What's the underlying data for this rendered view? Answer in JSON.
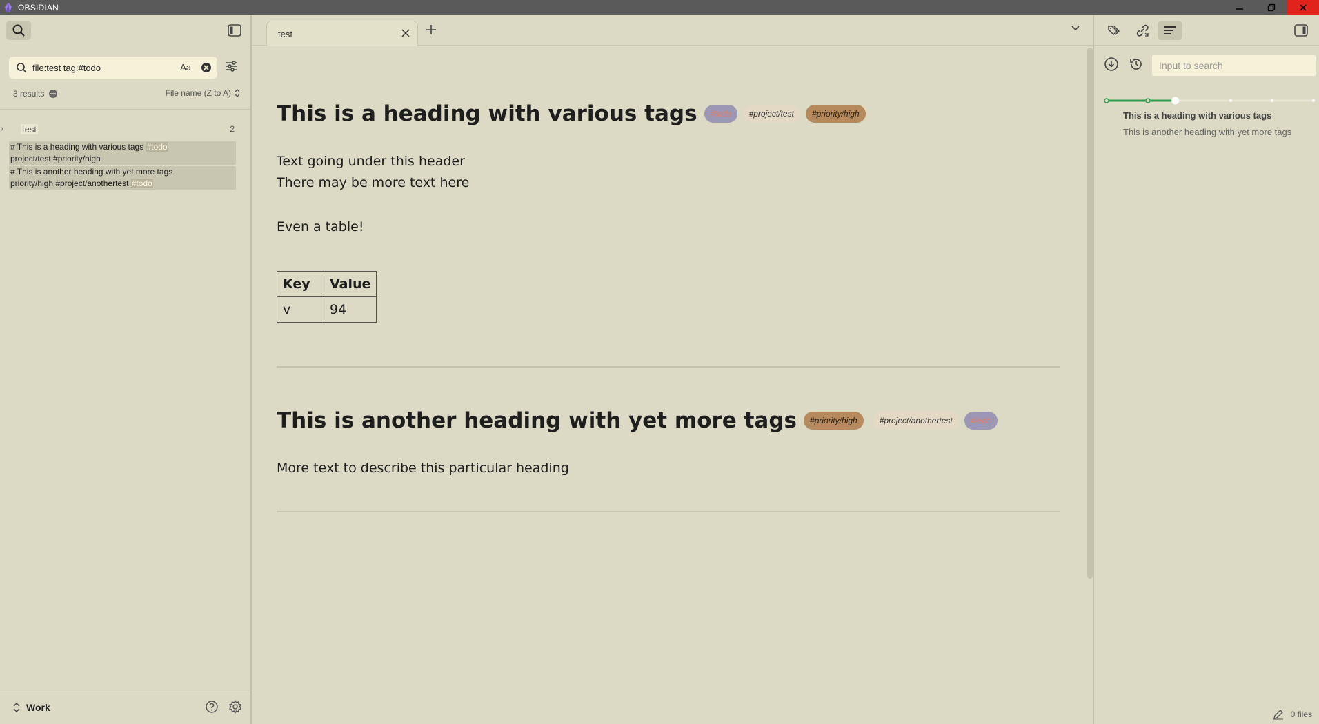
{
  "window": {
    "title": "OBSIDIAN"
  },
  "left_sidebar": {
    "search": {
      "query": "file:test tag:#todo",
      "match_case_label": "Aa"
    },
    "results_count": "3 results",
    "sort_label": "File name (Z to A)",
    "file_result": {
      "name": "test",
      "count": "2"
    },
    "matches": [
      {
        "line1_text": "# This is a heading with various tags ",
        "line1_hl": "#todo",
        "line2_text": "project/test #priority/high"
      },
      {
        "line1_text": "# This is another heading with yet more tags",
        "line2_text": "priority/high  #project/anothertest ",
        "line2_hl": "#todo"
      }
    ],
    "vault_name": "Work"
  },
  "tabs": [
    {
      "title": "test"
    }
  ],
  "document": {
    "heading1": "This is a heading with various tags",
    "heading1_tags": [
      "#todo",
      "#project/test",
      "#priority/high"
    ],
    "para_lines": [
      "Text going under this header",
      "There may be more text here"
    ],
    "para2": "Even a table!",
    "table": {
      "headers": [
        "Key",
        "Value"
      ],
      "rows": [
        [
          "v",
          "94"
        ]
      ]
    },
    "heading2": "This is another heading with yet more tags",
    "heading2_tags": [
      "#priority/high",
      "#project/anothertest",
      "#todo"
    ],
    "para3": "More text to describe this particular heading"
  },
  "right_panel": {
    "search_placeholder": "Input to search",
    "outline": [
      "This is a heading with various tags",
      "This is another heading with yet more tags"
    ],
    "status_files": "0 files",
    "level_slider": 0.33
  },
  "colors": {
    "background": "#dcd9c4",
    "accent_green": "#2e9e4f",
    "tag_todo_bg": "#9b97b4",
    "tag_todo_fg": "#e27e62",
    "tag_priority_bg": "#b68a5c",
    "tag_project_bg": "#e4d9c4",
    "close_button": "#e0231b"
  }
}
